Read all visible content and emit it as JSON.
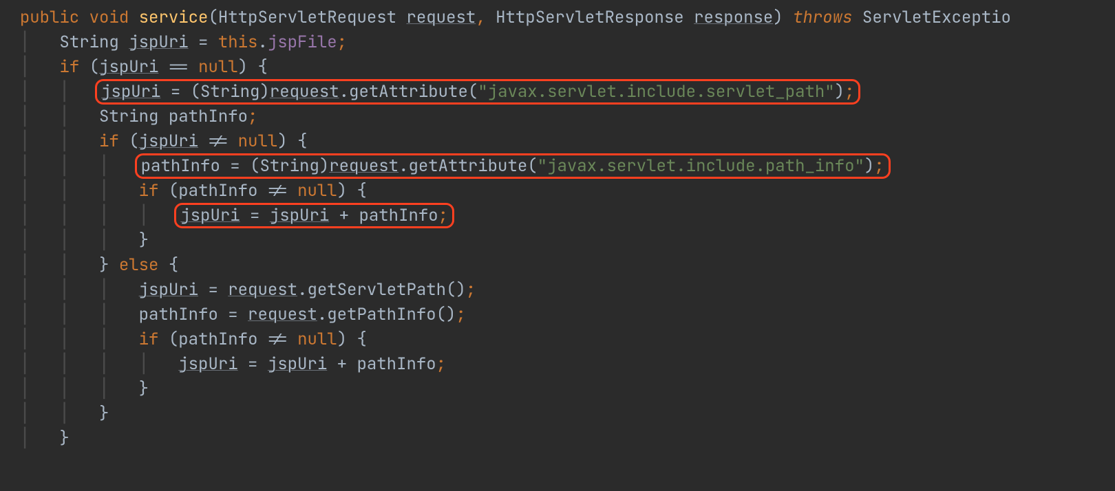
{
  "colors": {
    "background": "#2b2b2b",
    "keyword": "#cc7832",
    "function": "#ffc66d",
    "string": "#6a8759",
    "field": "#9876aa",
    "text": "#a9b7c6",
    "highlight_border": "#ff4020"
  },
  "tokens": {
    "kw_public": "public",
    "kw_void": "void",
    "fn_service": "service",
    "lparen1": "(",
    "t_req_type": "HttpServletRequest ",
    "t_req_name": "request",
    "comma1": ",",
    "sp1": " ",
    "t_res_type": "HttpServletResponse ",
    "t_res_name": "response",
    "rparen1": ") ",
    "kw_throws": "throws",
    "sp2": " ",
    "t_exc": "ServletExceptio",
    "l2_type": "String ",
    "l2_var": "jspUri",
    "l2_eq": " = ",
    "l2_this": "this",
    "l2_dot": ".",
    "l2_field": "jspFile",
    "l2_semi": ";",
    "l3_if": "if",
    "l3_open": " (",
    "l3_var": "jspUri",
    "l3_eqeq": " == ",
    "l3_null": "null",
    "l3_close": ") {",
    "l4_var": "jspUri",
    "l4_eq": " = (String)",
    "l4_req": "request",
    "l4_call": ".getAttribute(",
    "l4_str": "\"javax.servlet.include.servlet_path\"",
    "l4_end": ")",
    "l4_semi": ";",
    "l5_type": "String ",
    "l5_var": "pathInfo",
    "l5_semi": ";",
    "l6_if": "if",
    "l6_open": " (",
    "l6_var": "jspUri",
    "l6_neq": " != ",
    "l6_null": "null",
    "l6_close": ") {",
    "l7_var": "pathInfo",
    "l7_eq": " = (String)",
    "l7_req": "request",
    "l7_call": ".getAttribute(",
    "l7_str": "\"javax.servlet.include.path_info\"",
    "l7_end": ")",
    "l7_semi": ";",
    "l8_if": "if",
    "l8_open": " (",
    "l8_var": "pathInfo",
    "l8_neq": " != ",
    "l8_null": "null",
    "l8_close": ") {",
    "l9_var1": "jspUri",
    "l9_eq": " = ",
    "l9_var2": "jspUri",
    "l9_plus": " + ",
    "l9_var3": "pathInfo",
    "l9_semi": ";",
    "l10_close": "}",
    "l11_close_else": "} ",
    "l11_else": "else",
    "l11_open": " {",
    "l12_var": "jspUri",
    "l12_eq": " = ",
    "l12_req": "request",
    "l12_call": ".getServletPath()",
    "l12_semi": ";",
    "l13_var": "pathInfo",
    "l13_eq": " = ",
    "l13_req": "request",
    "l13_call": ".getPathInfo()",
    "l13_semi": ";",
    "l14_if": "if",
    "l14_open": " (",
    "l14_var": "pathInfo",
    "l14_neq": " != ",
    "l14_null": "null",
    "l14_close": ") {",
    "l15_var1": "jspUri",
    "l15_eq": " = ",
    "l15_var2": "jspUri",
    "l15_plus": " + ",
    "l15_var3": "pathInfo",
    "l15_semi": ";",
    "l16_close": "}",
    "l17_close": "}",
    "l18_close": "}"
  },
  "highlights": [
    "line4  jspUri = (String)request.getAttribute(\"javax.servlet.include.servlet_path\");",
    "line7  pathInfo = (String)request.getAttribute(\"javax.servlet.include.path_info\");",
    "line9  jspUri = jspUri + pathInfo;"
  ]
}
